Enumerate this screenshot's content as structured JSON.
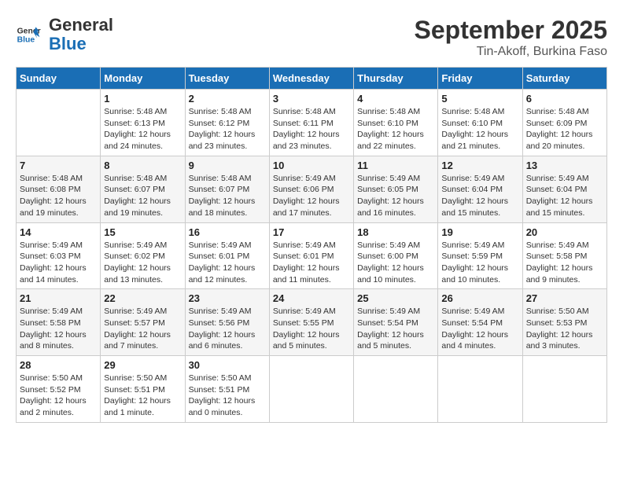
{
  "header": {
    "logo_line1": "General",
    "logo_line2": "Blue",
    "month": "September 2025",
    "location": "Tin-Akoff, Burkina Faso"
  },
  "days_of_week": [
    "Sunday",
    "Monday",
    "Tuesday",
    "Wednesday",
    "Thursday",
    "Friday",
    "Saturday"
  ],
  "weeks": [
    [
      {
        "day": "",
        "info": ""
      },
      {
        "day": "1",
        "info": "Sunrise: 5:48 AM\nSunset: 6:13 PM\nDaylight: 12 hours\nand 24 minutes."
      },
      {
        "day": "2",
        "info": "Sunrise: 5:48 AM\nSunset: 6:12 PM\nDaylight: 12 hours\nand 23 minutes."
      },
      {
        "day": "3",
        "info": "Sunrise: 5:48 AM\nSunset: 6:11 PM\nDaylight: 12 hours\nand 23 minutes."
      },
      {
        "day": "4",
        "info": "Sunrise: 5:48 AM\nSunset: 6:10 PM\nDaylight: 12 hours\nand 22 minutes."
      },
      {
        "day": "5",
        "info": "Sunrise: 5:48 AM\nSunset: 6:10 PM\nDaylight: 12 hours\nand 21 minutes."
      },
      {
        "day": "6",
        "info": "Sunrise: 5:48 AM\nSunset: 6:09 PM\nDaylight: 12 hours\nand 20 minutes."
      }
    ],
    [
      {
        "day": "7",
        "info": "Sunrise: 5:48 AM\nSunset: 6:08 PM\nDaylight: 12 hours\nand 19 minutes."
      },
      {
        "day": "8",
        "info": "Sunrise: 5:48 AM\nSunset: 6:07 PM\nDaylight: 12 hours\nand 19 minutes."
      },
      {
        "day": "9",
        "info": "Sunrise: 5:48 AM\nSunset: 6:07 PM\nDaylight: 12 hours\nand 18 minutes."
      },
      {
        "day": "10",
        "info": "Sunrise: 5:49 AM\nSunset: 6:06 PM\nDaylight: 12 hours\nand 17 minutes."
      },
      {
        "day": "11",
        "info": "Sunrise: 5:49 AM\nSunset: 6:05 PM\nDaylight: 12 hours\nand 16 minutes."
      },
      {
        "day": "12",
        "info": "Sunrise: 5:49 AM\nSunset: 6:04 PM\nDaylight: 12 hours\nand 15 minutes."
      },
      {
        "day": "13",
        "info": "Sunrise: 5:49 AM\nSunset: 6:04 PM\nDaylight: 12 hours\nand 15 minutes."
      }
    ],
    [
      {
        "day": "14",
        "info": "Sunrise: 5:49 AM\nSunset: 6:03 PM\nDaylight: 12 hours\nand 14 minutes."
      },
      {
        "day": "15",
        "info": "Sunrise: 5:49 AM\nSunset: 6:02 PM\nDaylight: 12 hours\nand 13 minutes."
      },
      {
        "day": "16",
        "info": "Sunrise: 5:49 AM\nSunset: 6:01 PM\nDaylight: 12 hours\nand 12 minutes."
      },
      {
        "day": "17",
        "info": "Sunrise: 5:49 AM\nSunset: 6:01 PM\nDaylight: 12 hours\nand 11 minutes."
      },
      {
        "day": "18",
        "info": "Sunrise: 5:49 AM\nSunset: 6:00 PM\nDaylight: 12 hours\nand 10 minutes."
      },
      {
        "day": "19",
        "info": "Sunrise: 5:49 AM\nSunset: 5:59 PM\nDaylight: 12 hours\nand 10 minutes."
      },
      {
        "day": "20",
        "info": "Sunrise: 5:49 AM\nSunset: 5:58 PM\nDaylight: 12 hours\nand 9 minutes."
      }
    ],
    [
      {
        "day": "21",
        "info": "Sunrise: 5:49 AM\nSunset: 5:58 PM\nDaylight: 12 hours\nand 8 minutes."
      },
      {
        "day": "22",
        "info": "Sunrise: 5:49 AM\nSunset: 5:57 PM\nDaylight: 12 hours\nand 7 minutes."
      },
      {
        "day": "23",
        "info": "Sunrise: 5:49 AM\nSunset: 5:56 PM\nDaylight: 12 hours\nand 6 minutes."
      },
      {
        "day": "24",
        "info": "Sunrise: 5:49 AM\nSunset: 5:55 PM\nDaylight: 12 hours\nand 5 minutes."
      },
      {
        "day": "25",
        "info": "Sunrise: 5:49 AM\nSunset: 5:54 PM\nDaylight: 12 hours\nand 5 minutes."
      },
      {
        "day": "26",
        "info": "Sunrise: 5:49 AM\nSunset: 5:54 PM\nDaylight: 12 hours\nand 4 minutes."
      },
      {
        "day": "27",
        "info": "Sunrise: 5:50 AM\nSunset: 5:53 PM\nDaylight: 12 hours\nand 3 minutes."
      }
    ],
    [
      {
        "day": "28",
        "info": "Sunrise: 5:50 AM\nSunset: 5:52 PM\nDaylight: 12 hours\nand 2 minutes."
      },
      {
        "day": "29",
        "info": "Sunrise: 5:50 AM\nSunset: 5:51 PM\nDaylight: 12 hours\nand 1 minute."
      },
      {
        "day": "30",
        "info": "Sunrise: 5:50 AM\nSunset: 5:51 PM\nDaylight: 12 hours\nand 0 minutes."
      },
      {
        "day": "",
        "info": ""
      },
      {
        "day": "",
        "info": ""
      },
      {
        "day": "",
        "info": ""
      },
      {
        "day": "",
        "info": ""
      }
    ]
  ]
}
